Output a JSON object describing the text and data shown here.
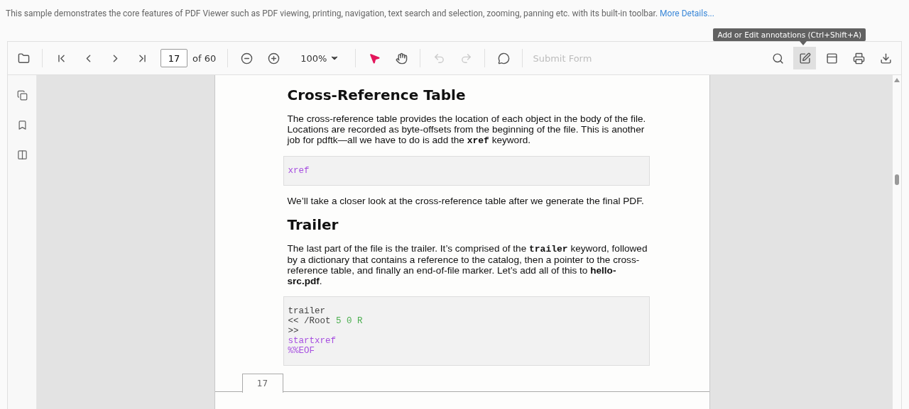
{
  "description": {
    "text": "This sample demonstrates the core features of PDF Viewer such as PDF viewing, printing, navigation, text search and selection, zooming, panning etc. with its built-in toolbar.",
    "link": "More Details..."
  },
  "toolbar": {
    "left_tools": [
      {
        "kind": "open",
        "selected": false,
        "disabled": false
      },
      {
        "kind": "separator"
      },
      {
        "kind": "first-page",
        "selected": false,
        "disabled": false
      },
      {
        "kind": "previous-page",
        "selected": false,
        "disabled": false
      },
      {
        "kind": "next-page",
        "selected": false,
        "disabled": false
      },
      {
        "kind": "last-page",
        "selected": false,
        "disabled": false
      },
      {
        "kind": "page-field",
        "value": "17",
        "total": "of 60"
      },
      {
        "kind": "separator"
      },
      {
        "kind": "zoom-out",
        "selected": false,
        "disabled": false
      },
      {
        "kind": "zoom-in",
        "selected": false,
        "disabled": false
      },
      {
        "kind": "zoom-dropdown",
        "value": "100%"
      },
      {
        "kind": "separator"
      },
      {
        "kind": "select-text",
        "selected": true,
        "disabled": false
      },
      {
        "kind": "pan",
        "selected": false,
        "disabled": false
      },
      {
        "kind": "separator"
      },
      {
        "kind": "undo",
        "selected": false,
        "disabled": true
      },
      {
        "kind": "redo",
        "selected": false,
        "disabled": true
      },
      {
        "kind": "separator"
      },
      {
        "kind": "comment",
        "selected": false,
        "disabled": false
      },
      {
        "kind": "separator"
      },
      {
        "kind": "text-button",
        "label": "Submit Form",
        "disabled": true
      }
    ],
    "right_tools": [
      {
        "kind": "search",
        "selected": false,
        "disabled": false
      },
      {
        "kind": "annotation",
        "selected": true,
        "disabled": false
      },
      {
        "kind": "form-designer",
        "selected": false,
        "disabled": false
      },
      {
        "kind": "print",
        "selected": false,
        "disabled": false
      },
      {
        "kind": "download",
        "selected": false,
        "disabled": false
      }
    ],
    "tooltip": "Add or Edit annotations (Ctrl+Shift+A)"
  },
  "sidebar": {
    "items": [
      {
        "kind": "thumbnails"
      },
      {
        "kind": "bookmarks"
      },
      {
        "kind": "organize"
      }
    ]
  },
  "page": {
    "blocks": [
      {
        "kind": "heading",
        "text": "Cross-Reference Table"
      },
      {
        "kind": "paragraph",
        "segments": [
          {
            "kind": "text",
            "text": "The cross-reference table provides the location of each object in the body of the file. Locations are recorded as byte-offsets from the beginning of the file. This is another job for pdftk—all we have to do is add the "
          },
          {
            "kind": "code",
            "text": "xref"
          },
          {
            "kind": "text",
            "text": " keyword."
          }
        ]
      },
      {
        "kind": "code",
        "lines": [
          [
            {
              "kind": "keyword",
              "text": "xref"
            }
          ]
        ]
      },
      {
        "kind": "paragraph",
        "segments": [
          {
            "kind": "text",
            "text": "We’ll take a closer look at the cross-reference table after we generate the final PDF."
          }
        ]
      },
      {
        "kind": "heading",
        "text": "Trailer"
      },
      {
        "kind": "paragraph",
        "segments": [
          {
            "kind": "text",
            "text": "The last part of the file is the trailer. It’s comprised of the "
          },
          {
            "kind": "code",
            "text": "trailer"
          },
          {
            "kind": "text",
            "text": " keyword, followed by a dictionary that contains a reference to the catalog, then a pointer to the cross-reference table, and finally an end-of-file marker. Let’s add all of this to "
          },
          {
            "kind": "bold",
            "text": "hello-src.pdf"
          },
          {
            "kind": "text",
            "text": "."
          }
        ]
      },
      {
        "kind": "code",
        "lines": [
          [
            {
              "kind": "plain",
              "text": "trailer"
            }
          ],
          [
            {
              "kind": "plain",
              "text": "<< /Root "
            },
            {
              "kind": "number",
              "text": "5 0 R"
            }
          ],
          [
            {
              "kind": "plain",
              "text": ">>"
            }
          ],
          [
            {
              "kind": "keyword",
              "text": "startxref"
            }
          ],
          [
            {
              "kind": "keyword",
              "text": "%%EOF"
            }
          ]
        ]
      }
    ],
    "page_number": "17"
  }
}
